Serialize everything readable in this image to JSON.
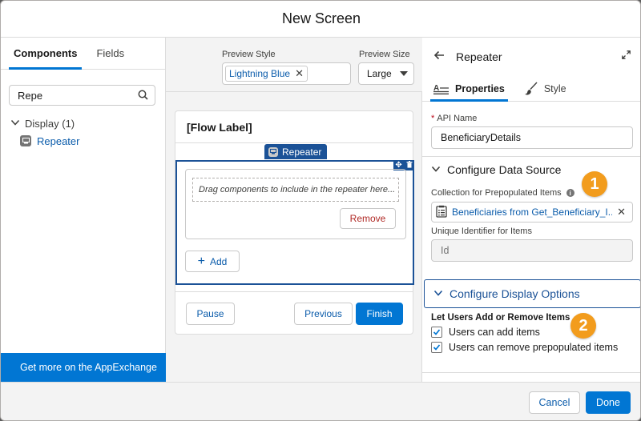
{
  "modal": {
    "title": "New Screen"
  },
  "left": {
    "tabs": [
      {
        "label": "Components"
      },
      {
        "label": "Fields"
      }
    ],
    "search_value": "Repe",
    "tree": {
      "group_label": "Display (1)",
      "item_label": "Repeater"
    },
    "appexchange_label": "Get more on the AppExchange"
  },
  "center": {
    "preview_style_label": "Preview Style",
    "preview_style_value": "Lightning Blue",
    "preview_size_label": "Preview Size",
    "preview_size_value": "Large",
    "flow_label": "[Flow Label]",
    "repeater_tag": "Repeater",
    "drop_hint": "Drag components to include in the repeater here...",
    "remove_label": "Remove",
    "add_label": "Add",
    "pause_label": "Pause",
    "previous_label": "Previous",
    "finish_label": "Finish"
  },
  "right": {
    "title": "Repeater",
    "tabs": [
      {
        "label": "Properties"
      },
      {
        "label": "Style"
      }
    ],
    "api_name_label": "API Name",
    "api_name_value": "BeneficiaryDetails",
    "data_source_section": "Configure Data Source",
    "collection_label": "Collection for Prepopulated Items",
    "collection_value": "Beneficiaries from Get_Beneficiary_I...",
    "unique_id_label": "Unique Identifier for Items",
    "unique_id_value": "Id",
    "display_section": "Configure Display Options",
    "add_remove_label": "Let Users Add or Remove Items",
    "check_add": "Users can add items",
    "check_remove": "Users can remove prepopulated items",
    "badge_1": "1",
    "badge_2": "2"
  },
  "footer": {
    "cancel_label": "Cancel",
    "done_label": "Done"
  },
  "colors": {
    "brand": "#0176d3",
    "selected_border": "#1b5297",
    "badge": "#f29c1d",
    "remove_text": "#b02a26"
  }
}
